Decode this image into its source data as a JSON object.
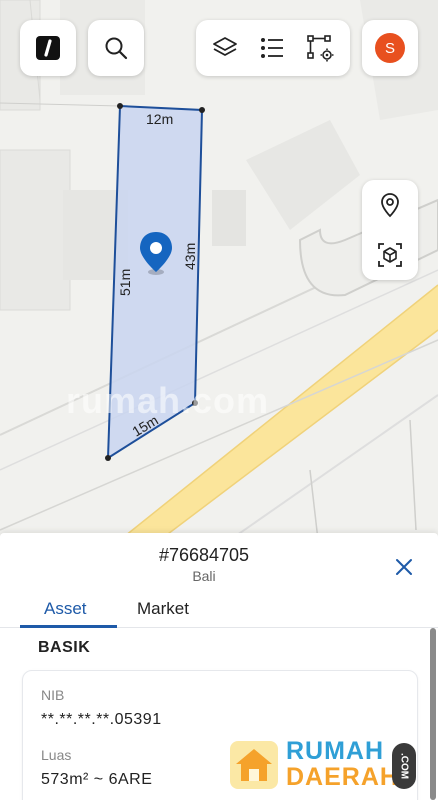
{
  "map": {
    "watermark": "rumah.com",
    "dimensions": {
      "top": "12m",
      "right": "43m",
      "left": "51m",
      "bottom": "15m"
    }
  },
  "toolbar": {
    "app_logo_icon": "app-logo-icon",
    "search_icon": "search-icon",
    "layers_icon": "layers-icon",
    "list_icon": "list-icon",
    "polygon_tool_icon": "polygon-settings-icon",
    "avatar_letter": "S",
    "avatar_color": "#e8501f"
  },
  "side_controls": {
    "pin_icon": "location-pin-icon",
    "scan_icon": "3d-box-icon"
  },
  "panel": {
    "parcel_id": "#76684705",
    "region": "Bali",
    "tabs": [
      {
        "label": "Asset",
        "active": true
      },
      {
        "label": "Market",
        "active": false
      }
    ],
    "section_title": "BASIK",
    "fields": [
      {
        "label": "NIB",
        "value": "**.**.**.**.05391"
      },
      {
        "label": "Luas",
        "value": "573m² ~ 6ARE"
      }
    ]
  },
  "branding": {
    "line1": "RUMAH",
    "line2": "DAERAH",
    "suffix": ".COM"
  },
  "colors": {
    "accent": "#1e5aa8",
    "parcel_fill": "#c9d5f0",
    "road": "#fbe59b"
  }
}
